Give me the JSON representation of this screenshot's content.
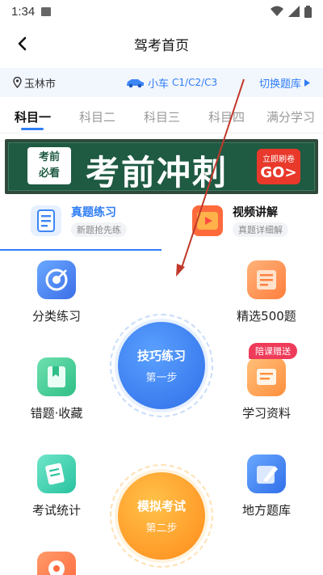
{
  "status_bar": {
    "time": "1:34"
  },
  "header": {
    "title": "驾考首页"
  },
  "location_bar": {
    "city": "玉林市",
    "car_type": "小车",
    "license_types": "C1/C2/C3",
    "switch_label": "切换题库"
  },
  "subject_tabs": [
    {
      "label": "科目一",
      "active": true
    },
    {
      "label": "科目二",
      "active": false
    },
    {
      "label": "科目三",
      "active": false
    },
    {
      "label": "科目四",
      "active": false
    },
    {
      "label": "满分学习",
      "active": false
    }
  ],
  "banner": {
    "tag_line1": "考前",
    "tag_line2": "必看",
    "headline": "考前冲刺",
    "button_top": "立即刷卷",
    "button_bottom": "GO>"
  },
  "mode_tabs": [
    {
      "title": "真题练习",
      "subtitle": "新题抢先练",
      "active": true,
      "accent": "#2f7df6"
    },
    {
      "title": "视频讲解",
      "subtitle": "真题详细解",
      "active": false,
      "accent": "#ff8a3d"
    }
  ],
  "features_left": [
    {
      "label": "分类练习",
      "icon": "target-icon"
    },
    {
      "label": "错题·收藏",
      "icon": "bookmark-icon"
    },
    {
      "label": "考试统计",
      "icon": "stats-icon"
    },
    {
      "label": "",
      "icon": "location-icon"
    }
  ],
  "features_right": [
    {
      "label": "精选500题",
      "icon": "document-icon"
    },
    {
      "label": "学习资料",
      "icon": "notes-icon"
    },
    {
      "label": "地方题库",
      "icon": "pen-icon"
    }
  ],
  "badge": {
    "text": "陪课赠送"
  },
  "practice_circle": {
    "title": "技巧练习",
    "step": "第一步",
    "color": "#2f7df6"
  },
  "exam_circle": {
    "title": "模拟考试",
    "step": "第二步",
    "color": "#ff9b20"
  }
}
